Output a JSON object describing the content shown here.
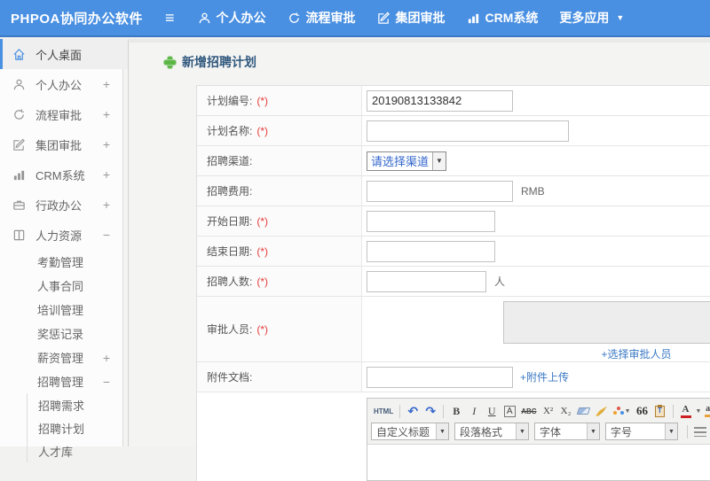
{
  "colors": {
    "accent_blue": "#4a90e2",
    "title_blue": "#31597e",
    "plus_green": "#5cb646",
    "required_red": "#e53c3c",
    "link_blue": "#3a78c3"
  },
  "header": {
    "logo": "PHPOA协同办公软件",
    "menu_icon": "≡",
    "caret": "▼",
    "items": [
      {
        "label": "个人办公"
      },
      {
        "label": "流程审批"
      },
      {
        "label": "集团审批"
      },
      {
        "label": "CRM系统"
      },
      {
        "label": "更多应用"
      }
    ]
  },
  "sidebar": {
    "items": [
      {
        "label": "个人桌面",
        "expand": ""
      },
      {
        "label": "个人办公",
        "expand": "+"
      },
      {
        "label": "流程审批",
        "expand": "+"
      },
      {
        "label": "集团审批",
        "expand": "+"
      },
      {
        "label": "CRM系统",
        "expand": "+"
      },
      {
        "label": "行政办公",
        "expand": "+"
      },
      {
        "label": "人力资源",
        "expand": "−"
      }
    ],
    "hr_children": [
      {
        "label": "考勤管理",
        "expand": ""
      },
      {
        "label": "人事合同",
        "expand": ""
      },
      {
        "label": "培训管理",
        "expand": ""
      },
      {
        "label": "奖惩记录",
        "expand": ""
      },
      {
        "label": "薪资管理",
        "expand": "+"
      },
      {
        "label": "招聘管理",
        "expand": "−"
      }
    ],
    "recruit_children": [
      {
        "label": "招聘需求"
      },
      {
        "label": "招聘计划"
      },
      {
        "label": "人才库"
      }
    ]
  },
  "main": {
    "title": "新增招聘计划",
    "form": {
      "required_mark": "(*)",
      "rows": [
        {
          "label": "计划编号:",
          "value": "20190813133842"
        },
        {
          "label": "计划名称:"
        },
        {
          "label": "招聘渠道:",
          "select_value": "请选择渠道"
        },
        {
          "label": "招聘费用:",
          "suffix": "RMB"
        },
        {
          "label": "开始日期:"
        },
        {
          "label": "结束日期:"
        },
        {
          "label": "招聘人数:",
          "suffix": "人"
        },
        {
          "label": "审批人员:",
          "link": "+选择审批人员"
        },
        {
          "label": "附件文档:",
          "link": "+附件上传"
        }
      ]
    },
    "editor": {
      "html_button": "HTML",
      "undo": "↶",
      "redo": "↷",
      "bold": "B",
      "italic": "I",
      "underline": "U",
      "boxed_a": "A",
      "strike": "ABC",
      "sup": "X²",
      "sub": "X₂",
      "quote": "66",
      "paste_t": "T",
      "font_color": "A",
      "highlight": "ab",
      "caret": "▼",
      "selects": [
        {
          "label": "自定义标题"
        },
        {
          "label": "段落格式"
        },
        {
          "label": "字体"
        },
        {
          "label": "字号"
        }
      ]
    }
  }
}
